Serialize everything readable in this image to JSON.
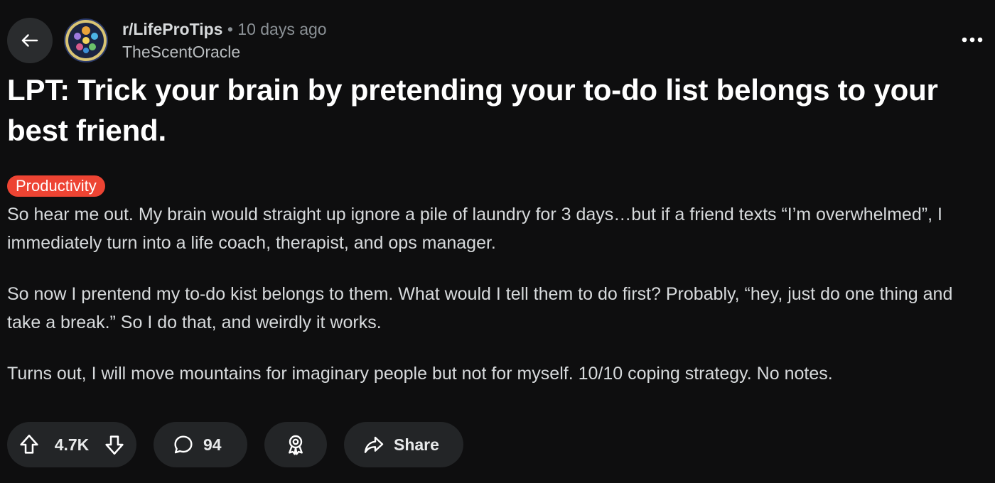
{
  "header": {
    "subreddit": "r/LifeProTips",
    "separator": "•",
    "time": "10 days ago",
    "author": "TheScentOracle"
  },
  "icons": {
    "back": "arrow-left-icon",
    "more": "more-dots-icon",
    "upvote": "upvote-arrow-icon",
    "downvote": "downvote-arrow-icon",
    "comment": "comment-bubble-icon",
    "award": "award-ribbon-icon",
    "share": "share-arrow-icon"
  },
  "post": {
    "title": "LPT: Trick your brain by pretending your to-do list belongs to your best friend.",
    "flair": "Productivity",
    "paragraphs": [
      "So hear me out. My brain would straight up ignore a pile of laundry for 3 days…but if a friend texts “I’m overwhelmed”, I immediately turn into a life coach, therapist, and ops manager.",
      "So now I prentend my to-do kist belongs to them. What would I tell them to do first? Probably, “hey, just do one thing and take a break.” So I do that, and weirdly it works.",
      "Turns out, I will move mountains for imaginary people but not for myself. 10/10 coping strategy. No notes."
    ]
  },
  "actions": {
    "votes": "4.7K",
    "comments": "94",
    "share": "Share"
  },
  "colors": {
    "background": "#0e0e0f",
    "pill": "#232527",
    "flair": "#ed4433",
    "title": "#ffffff",
    "body_text": "#d7dadc",
    "meta_text": "#8b9196"
  }
}
